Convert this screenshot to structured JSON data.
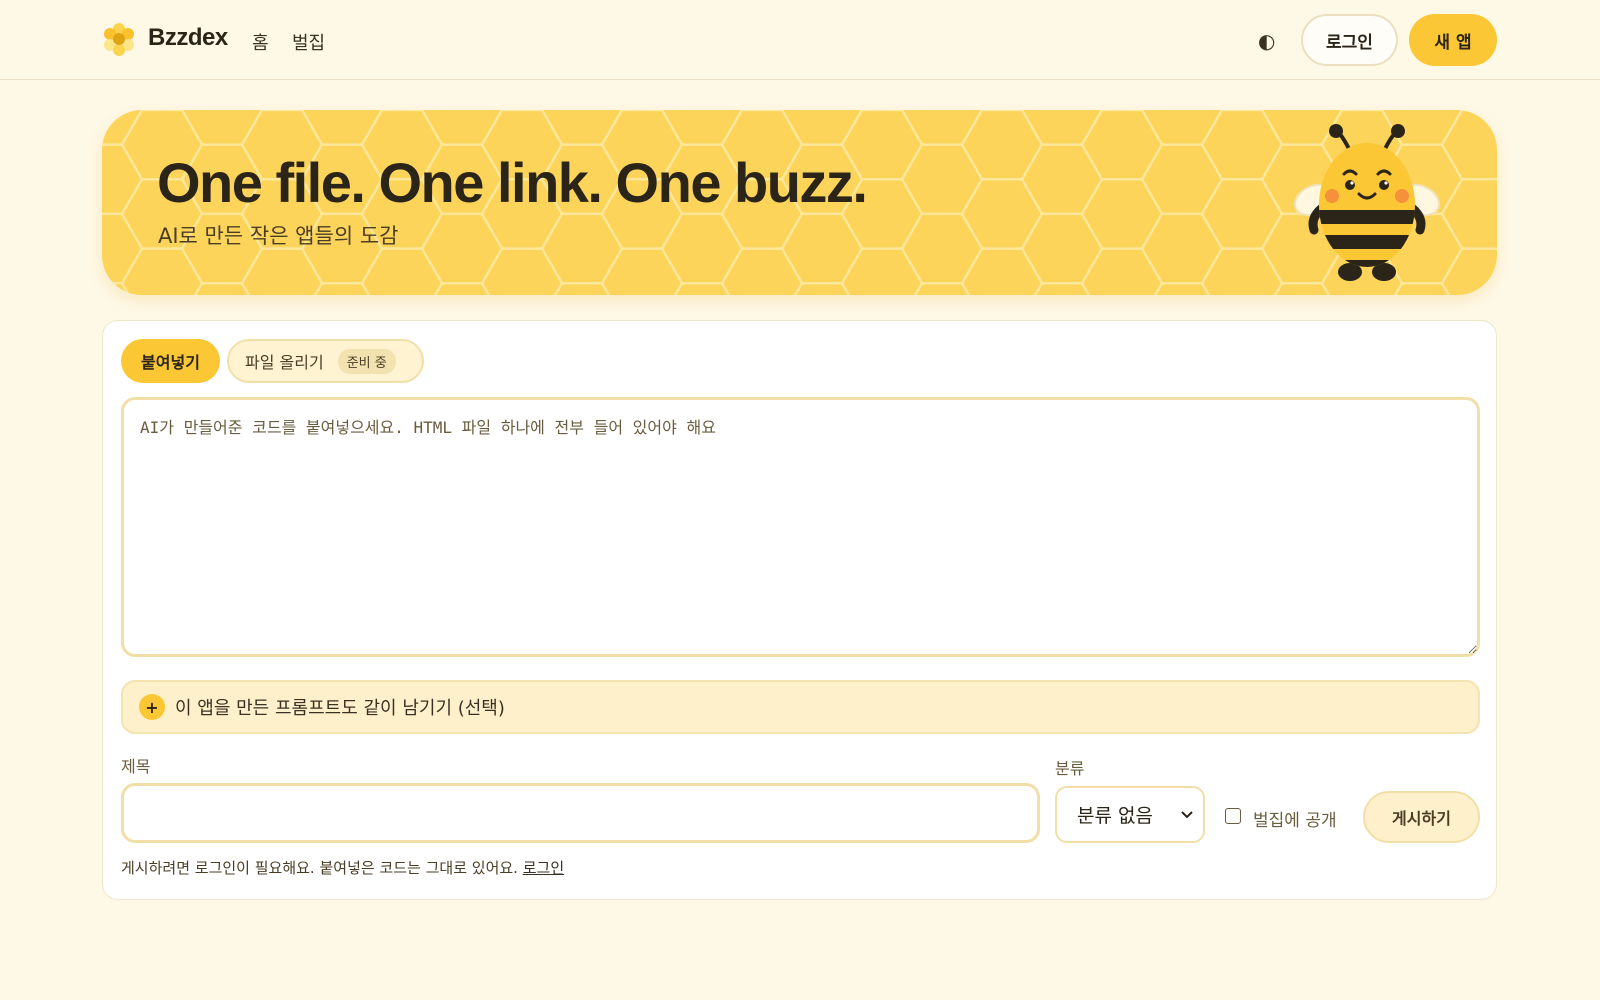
{
  "header": {
    "brand": "Bzzdex",
    "nav": {
      "home": "홈",
      "hive": "벌집"
    },
    "theme_toggle": "◐",
    "login_label": "로그인",
    "new_app_label": "새 앱"
  },
  "hero": {
    "title": "One file. One link. One buzz.",
    "subtitle": "AI로 만든 작은 앱들의 도감"
  },
  "composer": {
    "tabs": {
      "paste": "붙여넣기",
      "upload": "파일 올리기",
      "upload_badge": "준비 중"
    },
    "code_placeholder": "AI가 만들어준 코드를 붙여넣으세요. HTML 파일 하나에 전부 들어 있어야 해요",
    "prompt_toggle_icon": "+",
    "prompt_toggle_label": "이 앱을 만든 프롬프트도 같이 남기기 (선택)",
    "title_label": "제목",
    "title_value": "",
    "category_label": "분류",
    "category_selected": "분류 없음",
    "public_label": "벌집에 공개",
    "post_label": "게시하기",
    "hint_text": "게시하려면 로그인이 필요해요. 붙여넣은 코드는 그대로 있어요. ",
    "hint_link": "로그인"
  },
  "colors": {
    "background": "#fef8e6",
    "accent": "#fcc734",
    "hero_bg": "#fdd45a",
    "text": "#2b2418"
  },
  "icons": {
    "logo": "honeycomb-flower-icon",
    "theme": "half-circle-icon",
    "mascot": "bee-mascot",
    "select": "chevron-down-icon"
  }
}
